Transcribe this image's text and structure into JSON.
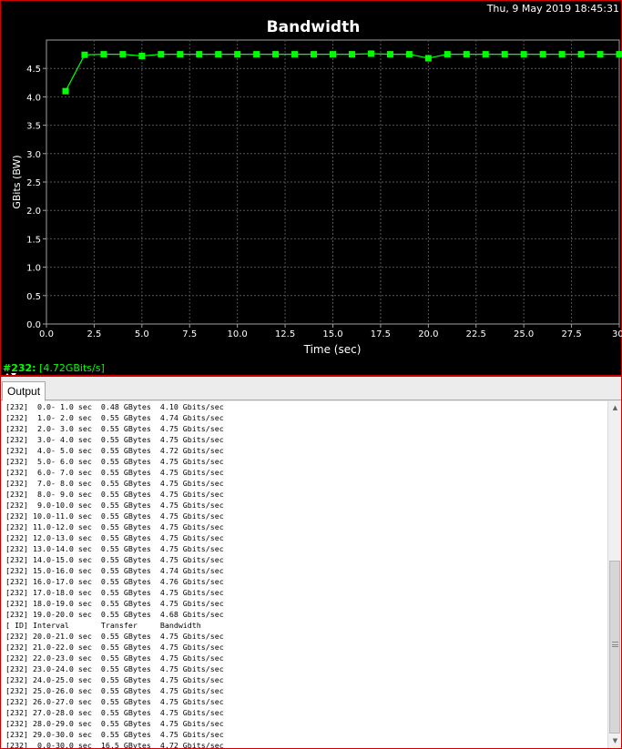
{
  "timestamp": "Thu, 9 May 2019 18:45:31",
  "status": {
    "id": "#232:",
    "value": "[4.72GBits/s]"
  },
  "chart_data": {
    "type": "line",
    "title": "Bandwidth",
    "xlabel": "Time (sec)",
    "ylabel": "GBits (BW)",
    "xlim": [
      0,
      30
    ],
    "ylim": [
      0,
      5
    ],
    "xticks": [
      "0.0",
      "2.5",
      "5.0",
      "7.5",
      "10.0",
      "12.5",
      "15.0",
      "17.5",
      "20.0",
      "22.5",
      "25.0",
      "27.5",
      "30."
    ],
    "yticks": [
      "0.0",
      "0.5",
      "1.0",
      "1.5",
      "2.0",
      "2.5",
      "3.0",
      "3.5",
      "4.0",
      "4.5"
    ],
    "grid": true,
    "colors": {
      "background": "#000000",
      "series": "#00ff00",
      "grid": "#555555",
      "text": "#ffffff"
    },
    "series": [
      {
        "x": [
          1,
          2,
          3,
          4,
          5,
          6,
          7,
          8,
          9,
          10,
          11,
          12,
          13,
          14,
          15,
          16,
          17,
          18,
          19,
          20,
          21,
          22,
          23,
          24,
          25,
          26,
          27,
          28,
          29,
          30
        ],
        "values": [
          4.1,
          4.74,
          4.75,
          4.75,
          4.72,
          4.75,
          4.75,
          4.75,
          4.75,
          4.75,
          4.75,
          4.75,
          4.75,
          4.75,
          4.75,
          4.75,
          4.76,
          4.75,
          4.75,
          4.68,
          4.75,
          4.75,
          4.75,
          4.75,
          4.75,
          4.75,
          4.75,
          4.75,
          4.75,
          4.75
        ]
      }
    ]
  },
  "output": {
    "tab_label": "Output",
    "lines": [
      "[232]  0.0- 1.0 sec  0.48 GBytes  4.10 Gbits/sec",
      "[232]  1.0- 2.0 sec  0.55 GBytes  4.74 Gbits/sec",
      "[232]  2.0- 3.0 sec  0.55 GBytes  4.75 Gbits/sec",
      "[232]  3.0- 4.0 sec  0.55 GBytes  4.75 Gbits/sec",
      "[232]  4.0- 5.0 sec  0.55 GBytes  4.72 Gbits/sec",
      "[232]  5.0- 6.0 sec  0.55 GBytes  4.75 Gbits/sec",
      "[232]  6.0- 7.0 sec  0.55 GBytes  4.75 Gbits/sec",
      "[232]  7.0- 8.0 sec  0.55 GBytes  4.75 Gbits/sec",
      "[232]  8.0- 9.0 sec  0.55 GBytes  4.75 Gbits/sec",
      "[232]  9.0-10.0 sec  0.55 GBytes  4.75 Gbits/sec",
      "[232] 10.0-11.0 sec  0.55 GBytes  4.75 Gbits/sec",
      "[232] 11.0-12.0 sec  0.55 GBytes  4.75 Gbits/sec",
      "[232] 12.0-13.0 sec  0.55 GBytes  4.75 Gbits/sec",
      "[232] 13.0-14.0 sec  0.55 GBytes  4.75 Gbits/sec",
      "[232] 14.0-15.0 sec  0.55 GBytes  4.75 Gbits/sec",
      "[232] 15.0-16.0 sec  0.55 GBytes  4.74 Gbits/sec",
      "[232] 16.0-17.0 sec  0.55 GBytes  4.76 Gbits/sec",
      "[232] 17.0-18.0 sec  0.55 GBytes  4.75 Gbits/sec",
      "[232] 18.0-19.0 sec  0.55 GBytes  4.75 Gbits/sec",
      "[232] 19.0-20.0 sec  0.55 GBytes  4.68 Gbits/sec",
      "[ ID] Interval       Transfer     Bandwidth",
      "[232] 20.0-21.0 sec  0.55 GBytes  4.75 Gbits/sec",
      "[232] 21.0-22.0 sec  0.55 GBytes  4.75 Gbits/sec",
      "[232] 22.0-23.0 sec  0.55 GBytes  4.75 Gbits/sec",
      "[232] 23.0-24.0 sec  0.55 GBytes  4.75 Gbits/sec",
      "[232] 24.0-25.0 sec  0.55 GBytes  4.75 Gbits/sec",
      "[232] 25.0-26.0 sec  0.55 GBytes  4.75 Gbits/sec",
      "[232] 26.0-27.0 sec  0.55 GBytes  4.75 Gbits/sec",
      "[232] 27.0-28.0 sec  0.55 GBytes  4.75 Gbits/sec",
      "[232] 28.0-29.0 sec  0.55 GBytes  4.75 Gbits/sec",
      "[232] 29.0-30.0 sec  0.55 GBytes  4.75 Gbits/sec",
      "[232]  0.0-30.0 sec  16.5 GBytes  4.72 Gbits/sec"
    ]
  },
  "scrollbar": {
    "up_icon": "triangle-up-icon",
    "down_icon": "triangle-down-icon",
    "grip_icon": "grip-lines-icon"
  }
}
